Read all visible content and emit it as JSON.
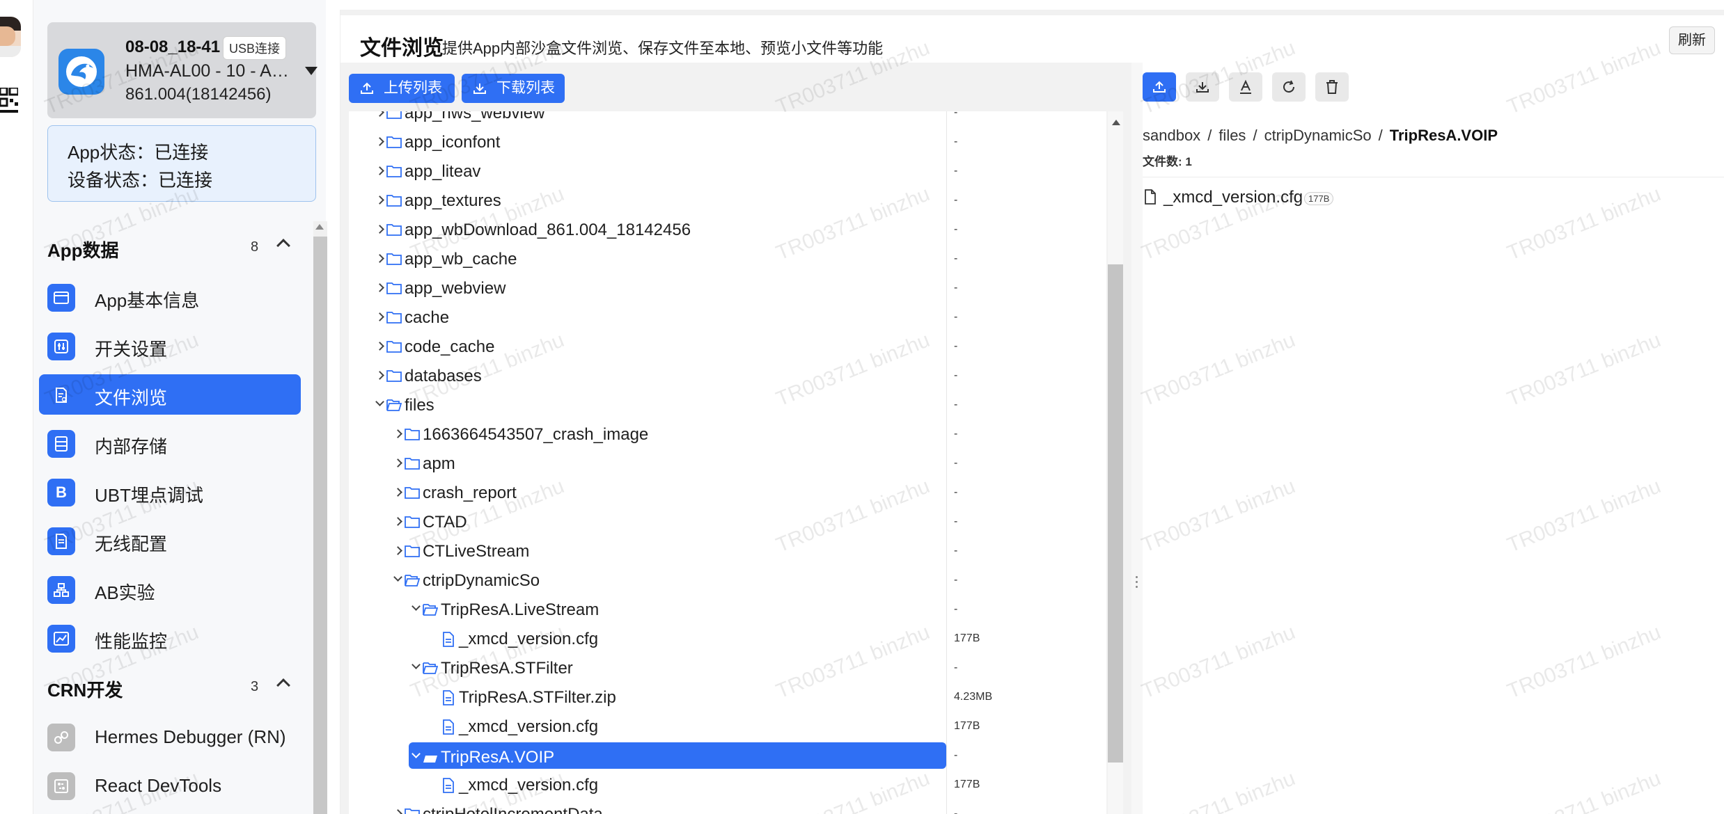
{
  "device": {
    "name": "08-08_18-41",
    "connection_tag": "USB连接",
    "model": "HMA-AL00 - 10 - AP...",
    "version": "861.004(18142456)"
  },
  "status": {
    "app_status": "App状态：已连接",
    "device_status": "设备状态：已连接"
  },
  "sections": [
    {
      "title": "App数据",
      "count": "8",
      "items": [
        {
          "label": "App基本信息",
          "icon": "card-icon"
        },
        {
          "label": "开关设置",
          "icon": "toggle-icon"
        },
        {
          "label": "文件浏览",
          "icon": "file-icon",
          "active": true
        },
        {
          "label": "内部存储",
          "icon": "storage-icon"
        },
        {
          "label": "UBT埋点调试",
          "icon": "b-letter-icon",
          "glyph": "B"
        },
        {
          "label": "无线配置",
          "icon": "document-icon"
        },
        {
          "label": "AB实验",
          "icon": "sitemap-icon"
        },
        {
          "label": "性能监控",
          "icon": "chart-icon"
        }
      ]
    },
    {
      "title": "CRN开发",
      "count": "3",
      "items": [
        {
          "label": "Hermes Debugger (RN)",
          "icon": "link-icon"
        },
        {
          "label": "React DevTools",
          "icon": "devtools-icon"
        }
      ]
    }
  ],
  "page": {
    "title": "文件浏览",
    "subtitle": "提供App内部沙盒文件浏览、保存文件至本地、预览小文件等功能",
    "refresh_label": "刷新"
  },
  "toolbar": {
    "upload_list": "上传列表",
    "download_list": "下载列表"
  },
  "tree": [
    {
      "label": "app_hws_webview",
      "type": "folder",
      "depth": 0,
      "expanded": false,
      "size": "-"
    },
    {
      "label": "app_iconfont",
      "type": "folder",
      "depth": 0,
      "expanded": false,
      "size": "-"
    },
    {
      "label": "app_liteav",
      "type": "folder",
      "depth": 0,
      "expanded": false,
      "size": "-"
    },
    {
      "label": "app_textures",
      "type": "folder",
      "depth": 0,
      "expanded": false,
      "size": "-"
    },
    {
      "label": "app_wbDownload_861.004_18142456",
      "type": "folder",
      "depth": 0,
      "expanded": false,
      "size": "-"
    },
    {
      "label": "app_wb_cache",
      "type": "folder",
      "depth": 0,
      "expanded": false,
      "size": "-"
    },
    {
      "label": "app_webview",
      "type": "folder",
      "depth": 0,
      "expanded": false,
      "size": "-"
    },
    {
      "label": "cache",
      "type": "folder",
      "depth": 0,
      "expanded": false,
      "size": "-"
    },
    {
      "label": "code_cache",
      "type": "folder",
      "depth": 0,
      "expanded": false,
      "size": "-"
    },
    {
      "label": "databases",
      "type": "folder",
      "depth": 0,
      "expanded": false,
      "size": "-"
    },
    {
      "label": "files",
      "type": "folder",
      "depth": 0,
      "expanded": true,
      "size": "-"
    },
    {
      "label": "1663664543507_crash_image",
      "type": "folder",
      "depth": 1,
      "expanded": false,
      "size": "-"
    },
    {
      "label": "apm",
      "type": "folder",
      "depth": 1,
      "expanded": false,
      "size": "-"
    },
    {
      "label": "crash_report",
      "type": "folder",
      "depth": 1,
      "expanded": false,
      "size": "-"
    },
    {
      "label": "CTAD",
      "type": "folder",
      "depth": 1,
      "expanded": false,
      "size": "-"
    },
    {
      "label": "CTLiveStream",
      "type": "folder",
      "depth": 1,
      "expanded": false,
      "size": "-"
    },
    {
      "label": "ctripDynamicSo",
      "type": "folder",
      "depth": 1,
      "expanded": true,
      "size": "-"
    },
    {
      "label": "TripResA.LiveStream",
      "type": "folder",
      "depth": 2,
      "expanded": true,
      "size": "-"
    },
    {
      "label": "_xmcd_version.cfg",
      "type": "file",
      "depth": 3,
      "size": "177B"
    },
    {
      "label": "TripResA.STFilter",
      "type": "folder",
      "depth": 2,
      "expanded": true,
      "size": "-"
    },
    {
      "label": "TripResA.STFilter.zip",
      "type": "file",
      "depth": 3,
      "size": "4.23MB"
    },
    {
      "label": "_xmcd_version.cfg",
      "type": "file",
      "depth": 3,
      "size": "177B"
    },
    {
      "label": "TripResA.VOIP",
      "type": "folder",
      "depth": 2,
      "expanded": true,
      "selected": true,
      "size": "-"
    },
    {
      "label": "_xmcd_version.cfg",
      "type": "file",
      "depth": 3,
      "size": "177B"
    },
    {
      "label": "ctripHotelIncrementData",
      "type": "folder",
      "depth": 1,
      "expanded": false,
      "size": "-"
    }
  ],
  "right": {
    "breadcrumb": [
      "sandbox",
      "files",
      "ctripDynamicSo",
      "TripResA.VOIP"
    ],
    "file_count": "文件数: 1",
    "files": [
      {
        "name": "_xmcd_version.cfg",
        "size": "177B"
      }
    ],
    "actions": [
      "upload-icon",
      "download-icon",
      "text-preview-icon",
      "refresh-icon",
      "delete-icon"
    ]
  },
  "watermark": "TR003711 binzhu",
  "colors": {
    "accent": "#2f6ff4",
    "device_card": "#d8d9dc",
    "status_card": "#e8f1fd",
    "app_logo": "#2b86e8"
  }
}
